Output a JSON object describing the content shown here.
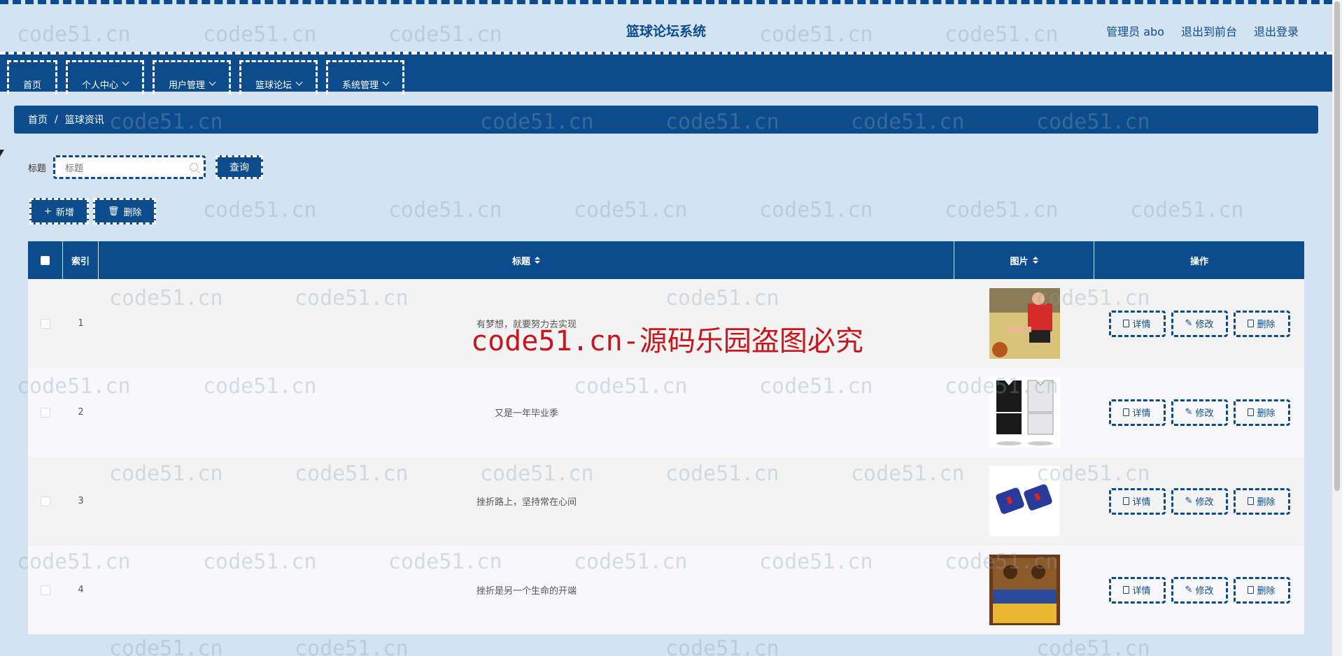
{
  "header": {
    "title": "篮球论坛系统",
    "user": "管理员 abo",
    "back_front": "退出到前台",
    "logout": "退出登录"
  },
  "nav": {
    "items": [
      {
        "label": "首页",
        "dropdown": false
      },
      {
        "label": "个人中心",
        "dropdown": true
      },
      {
        "label": "用户管理",
        "dropdown": true
      },
      {
        "label": "篮球论坛",
        "dropdown": true
      },
      {
        "label": "系统管理",
        "dropdown": true
      }
    ]
  },
  "breadcrumb": {
    "home": "首页",
    "separator": "/",
    "current": "篮球资讯"
  },
  "search": {
    "label": "标题",
    "placeholder": "标题",
    "query_button": "查询"
  },
  "actions": {
    "add": "新增",
    "delete": "删除"
  },
  "table": {
    "headers": {
      "index": "索引",
      "title": "标题",
      "image": "图片",
      "operation": "操作"
    },
    "rows": [
      {
        "index": "1",
        "title": "有梦想，就要努力去实现",
        "image_desc": "player-dribbling"
      },
      {
        "index": "2",
        "title": "又是一年毕业季",
        "image_desc": "jerseys"
      },
      {
        "index": "3",
        "title": "挫折路上，坚持常在心间",
        "image_desc": "wristbands"
      },
      {
        "index": "4",
        "title": "挫折是另一个生命的开端",
        "image_desc": "book-cover"
      }
    ],
    "row_actions": {
      "detail": "详情",
      "edit": "修改",
      "delete": "删除"
    }
  },
  "watermark": {
    "text": "code51.cn",
    "red_text": "code51.cn-源码乐园盗图必究"
  },
  "colors": {
    "primary": "#0d4c8c",
    "background": "#d3e3f2",
    "watermark_red": "#c8161d"
  }
}
